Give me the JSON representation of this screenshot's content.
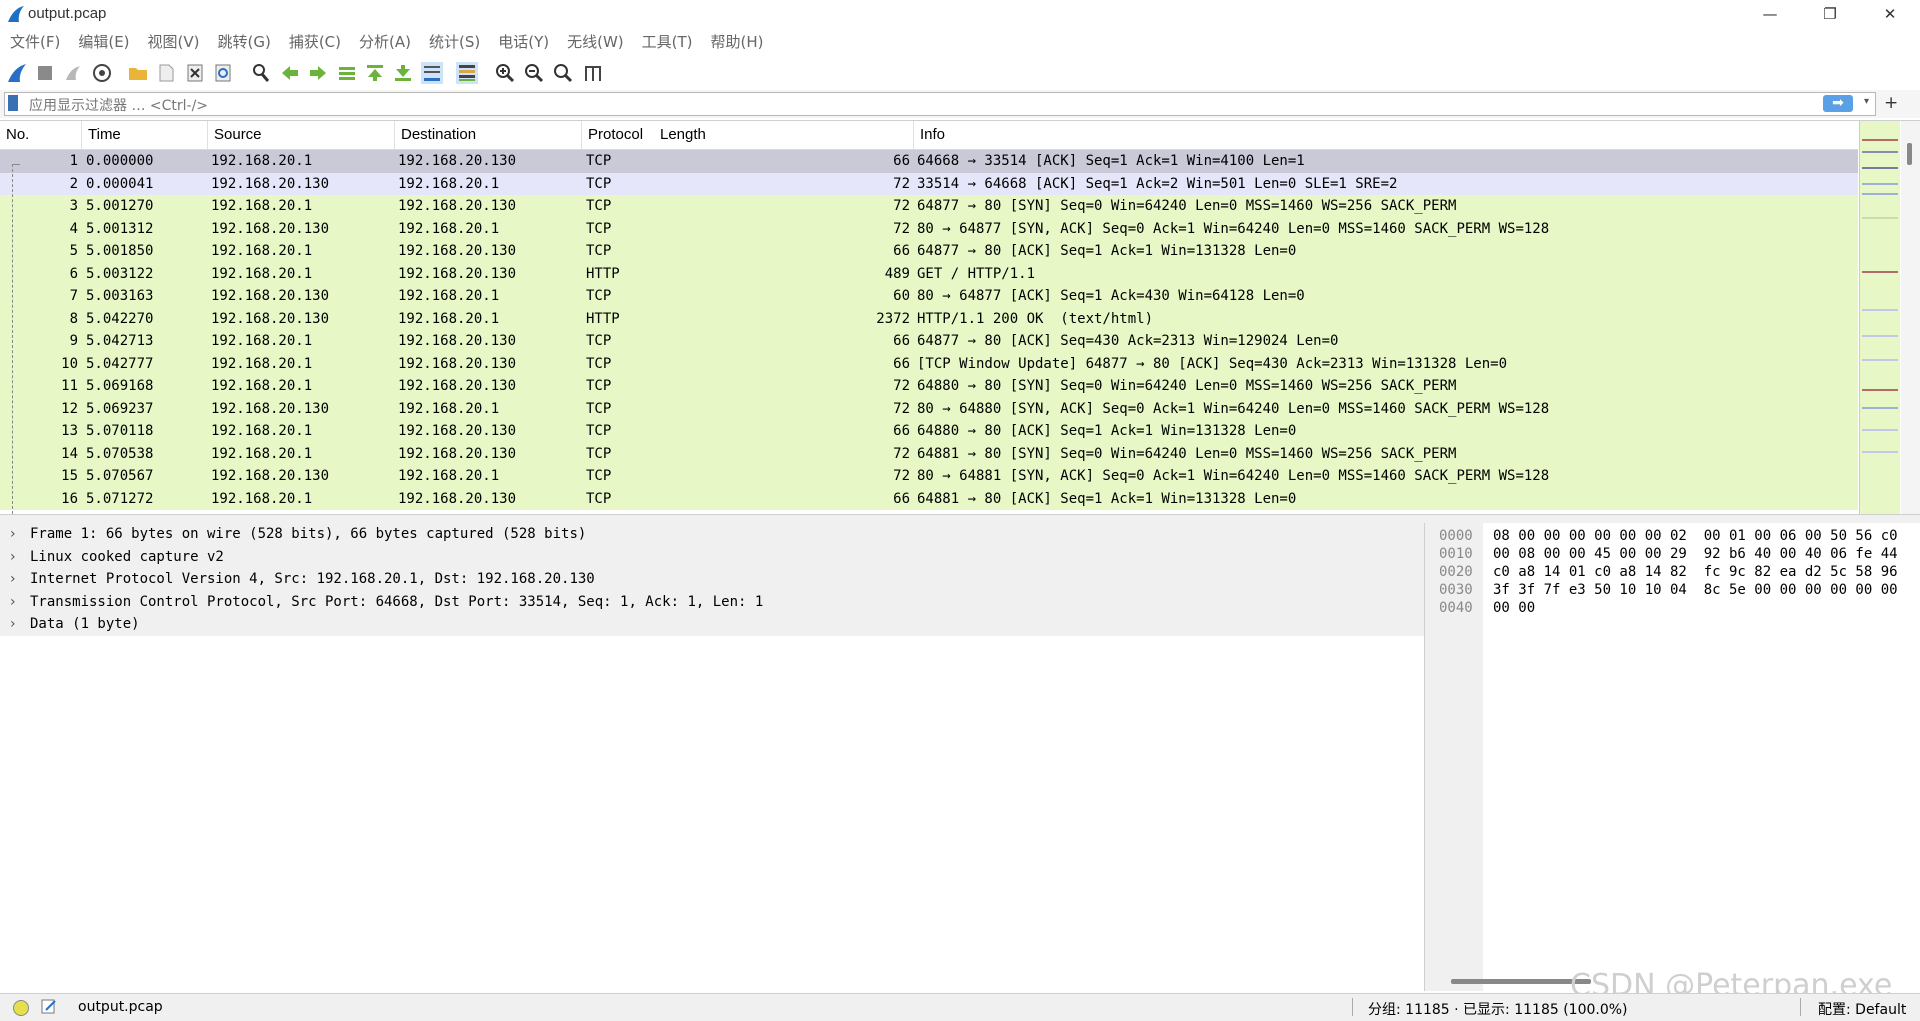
{
  "window": {
    "title": "output.pcap",
    "min": "—",
    "max": "❐",
    "close": "✕"
  },
  "menu": [
    "文件(F)",
    "编辑(E)",
    "视图(V)",
    "跳转(G)",
    "捕获(C)",
    "分析(A)",
    "统计(S)",
    "电话(Y)",
    "无线(W)",
    "工具(T)",
    "帮助(H)"
  ],
  "toolbar": [
    "shark-fin-start-icon",
    "stop-icon",
    "restart-icon",
    "options-gear-icon",
    "open-folder-icon",
    "open-file-icon",
    "close-file-icon",
    "reload-icon",
    "find-icon",
    "go-back-icon",
    "go-forward-icon",
    "go-to-packet-icon",
    "first-packet-icon",
    "last-packet-icon",
    "autoscroll-icon",
    "colorize-icon",
    "zoom-in-icon",
    "zoom-out-icon",
    "normal-size-icon",
    "resize-columns-icon"
  ],
  "filter": {
    "placeholder": "应用显示过滤器 … <Ctrl-/>",
    "apply": "➡",
    "dropdown": "▾",
    "add": "+"
  },
  "columns": {
    "no": "No.",
    "time": "Time",
    "source": "Source",
    "destination": "Destination",
    "protocol": "Protocol",
    "length": "Length",
    "info": "Info"
  },
  "colors": {
    "selected": "#c9c9d8",
    "related": "#e6e6fa",
    "tcp": "#e7f8c6",
    "http": "#e7f8c6"
  },
  "packets": [
    {
      "no": "1",
      "time": "0.000000",
      "src": "192.168.20.1",
      "dst": "192.168.20.130",
      "proto": "TCP",
      "len": "66",
      "info": "64668 → 33514 [ACK] Seq=1 Ack=1 Win=4100 Len=1",
      "state": "selected"
    },
    {
      "no": "2",
      "time": "0.000041",
      "src": "192.168.20.130",
      "dst": "192.168.20.1",
      "proto": "TCP",
      "len": "72",
      "info": "33514 → 64668 [ACK] Seq=1 Ack=2 Win=501 Len=0 SLE=1 SRE=2",
      "state": "related"
    },
    {
      "no": "3",
      "time": "5.001270",
      "src": "192.168.20.1",
      "dst": "192.168.20.130",
      "proto": "TCP",
      "len": "72",
      "info": "64877 → 80 [SYN] Seq=0 Win=64240 Len=0 MSS=1460 WS=256 SACK_PERM",
      "state": "normal"
    },
    {
      "no": "4",
      "time": "5.001312",
      "src": "192.168.20.130",
      "dst": "192.168.20.1",
      "proto": "TCP",
      "len": "72",
      "info": "80 → 64877 [SYN, ACK] Seq=0 Ack=1 Win=64240 Len=0 MSS=1460 SACK_PERM WS=128",
      "state": "normal"
    },
    {
      "no": "5",
      "time": "5.001850",
      "src": "192.168.20.1",
      "dst": "192.168.20.130",
      "proto": "TCP",
      "len": "66",
      "info": "64877 → 80 [ACK] Seq=1 Ack=1 Win=131328 Len=0",
      "state": "normal"
    },
    {
      "no": "6",
      "time": "5.003122",
      "src": "192.168.20.1",
      "dst": "192.168.20.130",
      "proto": "HTTP",
      "len": "489",
      "info": "GET / HTTP/1.1",
      "state": "normal"
    },
    {
      "no": "7",
      "time": "5.003163",
      "src": "192.168.20.130",
      "dst": "192.168.20.1",
      "proto": "TCP",
      "len": "60",
      "info": "80 → 64877 [ACK] Seq=1 Ack=430 Win=64128 Len=0",
      "state": "normal"
    },
    {
      "no": "8",
      "time": "5.042270",
      "src": "192.168.20.130",
      "dst": "192.168.20.1",
      "proto": "HTTP",
      "len": "2372",
      "info": "HTTP/1.1 200 OK  (text/html)",
      "state": "normal"
    },
    {
      "no": "9",
      "time": "5.042713",
      "src": "192.168.20.1",
      "dst": "192.168.20.130",
      "proto": "TCP",
      "len": "66",
      "info": "64877 → 80 [ACK] Seq=430 Ack=2313 Win=129024 Len=0",
      "state": "normal"
    },
    {
      "no": "10",
      "time": "5.042777",
      "src": "192.168.20.1",
      "dst": "192.168.20.130",
      "proto": "TCP",
      "len": "66",
      "info": "[TCP Window Update] 64877 → 80 [ACK] Seq=430 Ack=2313 Win=131328 Len=0",
      "state": "normal"
    },
    {
      "no": "11",
      "time": "5.069168",
      "src": "192.168.20.1",
      "dst": "192.168.20.130",
      "proto": "TCP",
      "len": "72",
      "info": "64880 → 80 [SYN] Seq=0 Win=64240 Len=0 MSS=1460 WS=256 SACK_PERM",
      "state": "normal"
    },
    {
      "no": "12",
      "time": "5.069237",
      "src": "192.168.20.130",
      "dst": "192.168.20.1",
      "proto": "TCP",
      "len": "72",
      "info": "80 → 64880 [SYN, ACK] Seq=0 Ack=1 Win=64240 Len=0 MSS=1460 SACK_PERM WS=128",
      "state": "normal"
    },
    {
      "no": "13",
      "time": "5.070118",
      "src": "192.168.20.1",
      "dst": "192.168.20.130",
      "proto": "TCP",
      "len": "66",
      "info": "64880 → 80 [ACK] Seq=1 Ack=1 Win=131328 Len=0",
      "state": "normal"
    },
    {
      "no": "14",
      "time": "5.070538",
      "src": "192.168.20.1",
      "dst": "192.168.20.130",
      "proto": "TCP",
      "len": "72",
      "info": "64881 → 80 [SYN] Seq=0 Win=64240 Len=0 MSS=1460 WS=256 SACK_PERM",
      "state": "normal"
    },
    {
      "no": "15",
      "time": "5.070567",
      "src": "192.168.20.130",
      "dst": "192.168.20.1",
      "proto": "TCP",
      "len": "72",
      "info": "80 → 64881 [SYN, ACK] Seq=0 Ack=1 Win=64240 Len=0 MSS=1460 SACK_PERM WS=128",
      "state": "normal"
    },
    {
      "no": "16",
      "time": "5.071272",
      "src": "192.168.20.1",
      "dst": "192.168.20.130",
      "proto": "TCP",
      "len": "66",
      "info": "64881 → 80 [ACK] Seq=1 Ack=1 Win=131328 Len=0",
      "state": "normal"
    }
  ],
  "details": [
    "Frame 1: 66 bytes on wire (528 bits), 66 bytes captured (528 bits)",
    "Linux cooked capture v2",
    "Internet Protocol Version 4, Src: 192.168.20.1, Dst: 192.168.20.130",
    "Transmission Control Protocol, Src Port: 64668, Dst Port: 33514, Seq: 1, Ack: 1, Len: 1",
    "Data (1 byte)"
  ],
  "bytes": [
    {
      "off": "0000",
      "hex": "08 00 00 00 00 00 00 02  00 01 00 06 00 50 56 c0"
    },
    {
      "off": "0010",
      "hex": "00 08 00 00 45 00 00 29  92 b6 40 00 40 06 fe 44"
    },
    {
      "off": "0020",
      "hex": "c0 a8 14 01 c0 a8 14 82  fc 9c 82 ea d2 5c 58 96"
    },
    {
      "off": "0030",
      "hex": "3f 3f 7f e3 50 10 10 04  8c 5e 00 00 00 00 00 00"
    },
    {
      "off": "0040",
      "hex": "00 00"
    }
  ],
  "status": {
    "file": "output.pcap",
    "packets": "分组: 11185 · 已显示: 11185 (100.0%)",
    "profile": "配置: Default"
  },
  "watermark": "CSDN @Peterpan.exe"
}
